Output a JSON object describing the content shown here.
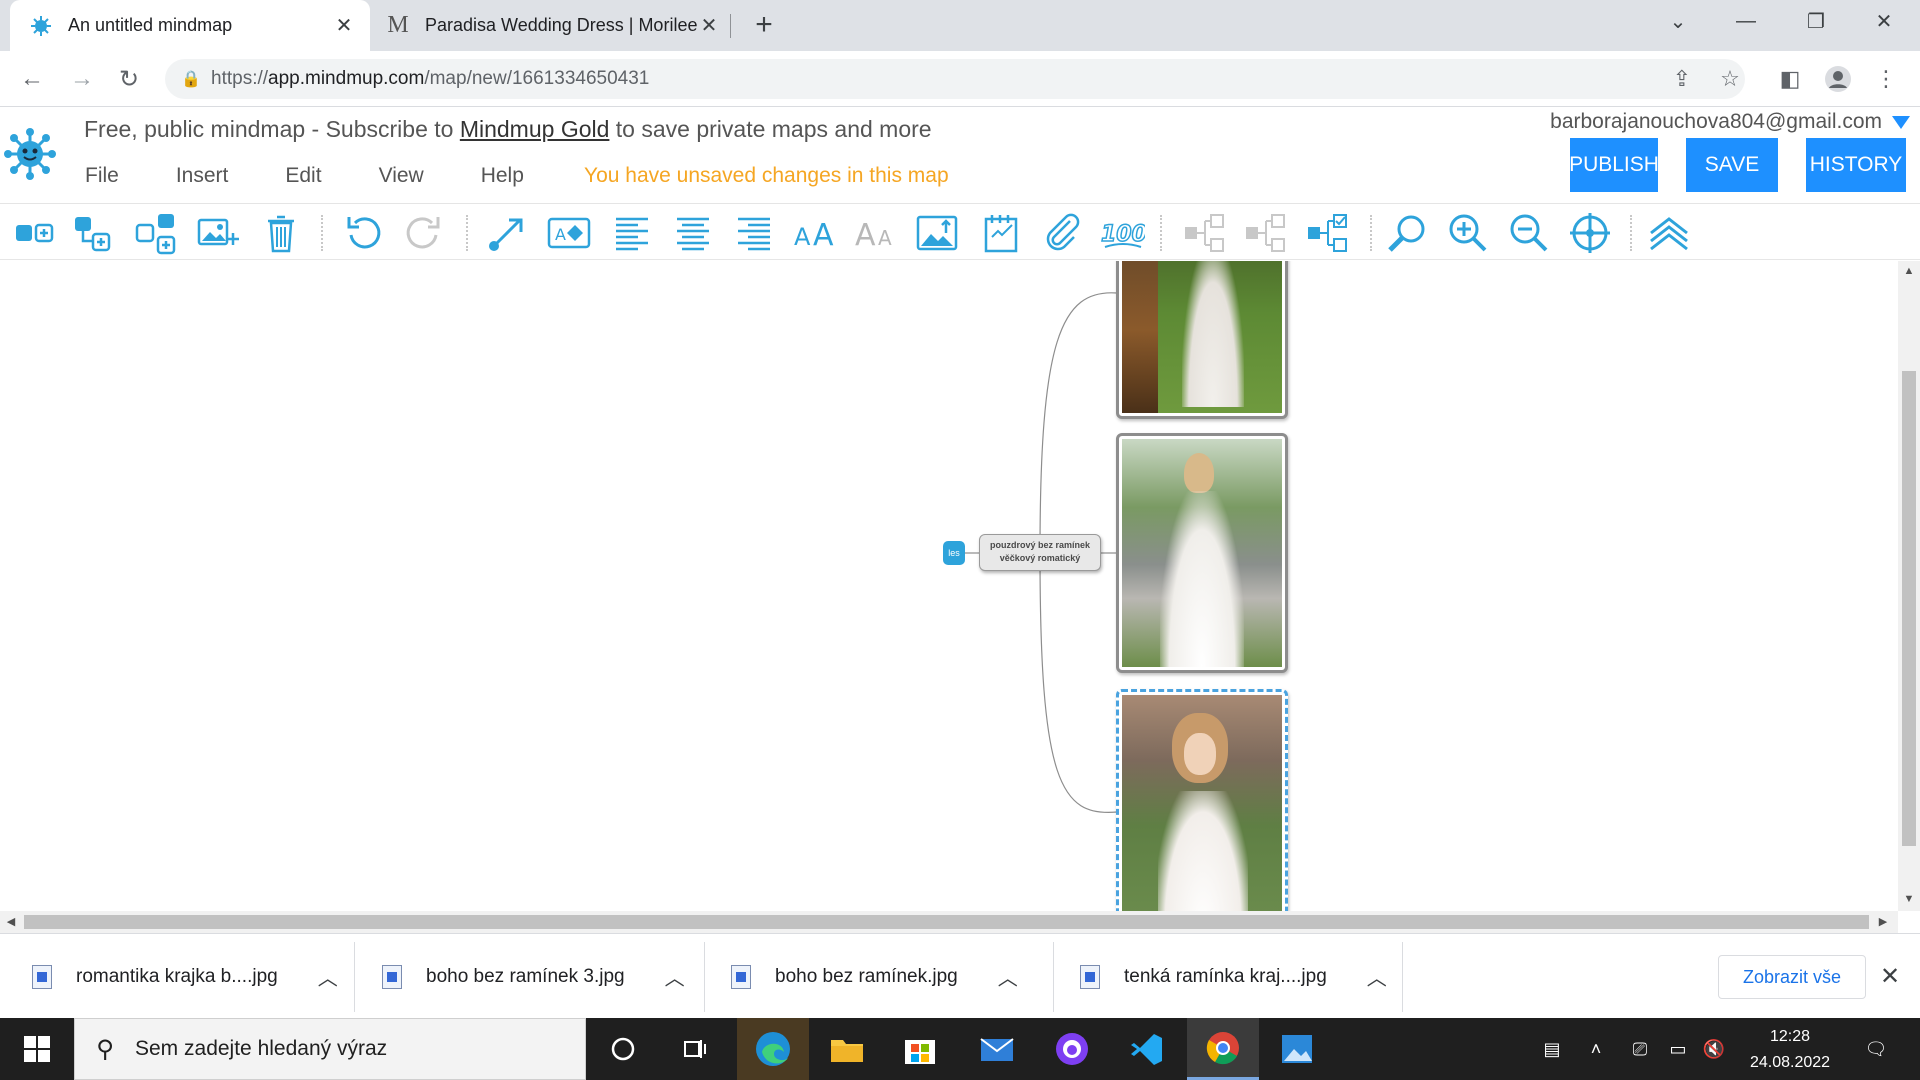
{
  "browser": {
    "tabs": [
      {
        "title": "An untitled mindmap",
        "active": true
      },
      {
        "title": "Paradisa Wedding Dress | Morilee",
        "active": false
      }
    ],
    "url_prefix": "https://",
    "url_host": "app.mindmup.com",
    "url_path": "/map/new/1661334650431"
  },
  "app": {
    "banner_before": "Free, public mindmap - Subscribe to ",
    "banner_link": "Mindmup Gold",
    "banner_after": " to save private maps and more",
    "email": "barborajanouchova804@gmail.com",
    "menu": [
      "File",
      "Insert",
      "Edit",
      "View",
      "Help"
    ],
    "unsaved_message": "You have unsaved changes in this map",
    "buttons": {
      "publish": "PUBLISH",
      "save": "SAVE",
      "history": "HISTORY"
    },
    "accent_color": "#1e90ff",
    "warning_color": "#f5a623"
  },
  "mindmap": {
    "root_node_line1": "pouzdrový bez ramínek",
    "root_node_line2": "věčkový romatický",
    "small_node_label": "les"
  },
  "downloads": {
    "items": [
      "romantika krajka b....jpg",
      "boho bez ramínek 3.jpg",
      "boho bez ramínek.jpg",
      "tenká ramínka kraj....jpg"
    ],
    "show_all": "Zobrazit vše"
  },
  "taskbar": {
    "search_placeholder": "Sem zadejte hledaný výraz",
    "time": "12:28",
    "date": "24.08.2022"
  }
}
